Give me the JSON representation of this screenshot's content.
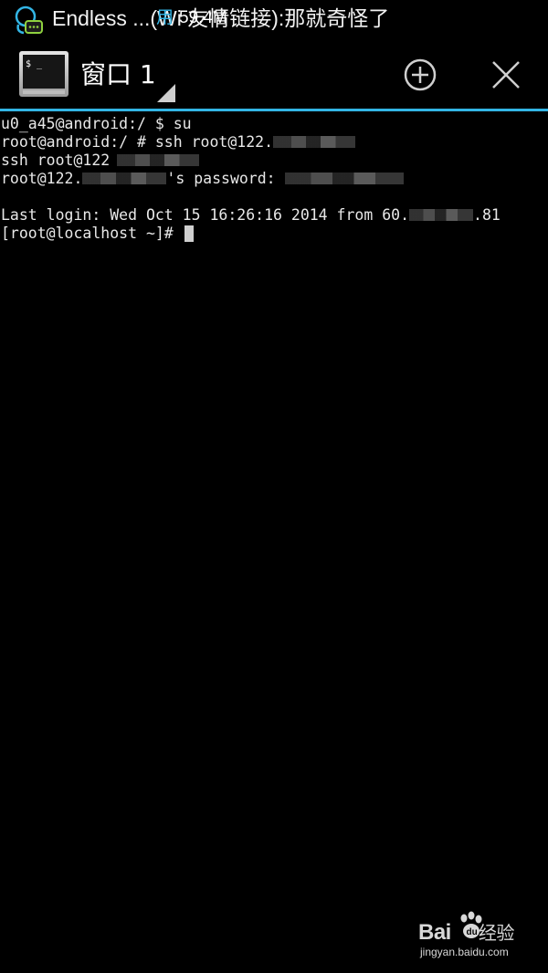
{
  "status_bar": {
    "notification_icon": "chat-bubble-person-icon",
    "notification_text": "Endless ...(Wi 友情链接):那就奇怪了",
    "overlay_used": "用",
    "overlay_memory": "59.4M"
  },
  "action_bar": {
    "app_icon": "terminal-emulator-icon",
    "window_title": "窗口 1",
    "add_icon": "plus-circle-icon",
    "close_icon": "close-x-icon",
    "accent_color": "#33b5e5"
  },
  "terminal": {
    "lines": [
      {
        "text": "u0_a45@android:/ $ su"
      },
      {
        "text": "root@android:/ # ssh root@122."
      },
      {
        "text": "ssh root@122"
      },
      {
        "prefix": "root@122.",
        "suffix": "'s password: "
      },
      {
        "text": ""
      },
      {
        "prefix": "Last login: Wed Oct 15 16:26:16 2014 from 60.",
        "suffix": ".81"
      },
      {
        "text": "[root@localhost ~]# "
      }
    ]
  },
  "watermark": {
    "brand_left": "Bai",
    "brand_right": "经验",
    "url": "jingyan.baidu.com"
  }
}
